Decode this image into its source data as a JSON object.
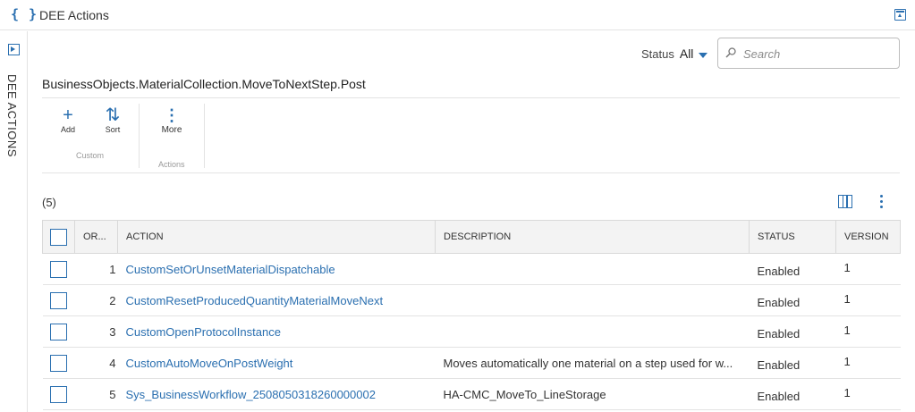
{
  "app": {
    "title": "DEE Actions",
    "rail_label": "DEE ACTIONS"
  },
  "filter": {
    "status_label": "Status",
    "status_value": "All"
  },
  "search": {
    "placeholder": "Search"
  },
  "entity_title": "BusinessObjects.MaterialCollection.MoveToNextStep.Post",
  "toolbar": {
    "add_label": "Add",
    "sort_label": "Sort",
    "custom_group": "Custom",
    "more_label": "More",
    "actions_group": "Actions"
  },
  "grid": {
    "count": "(5)",
    "columns": {
      "order": "OR...",
      "action": "ACTION",
      "description": "DESCRIPTION",
      "status": "STATUS",
      "version": "VERSION"
    },
    "rows": [
      {
        "order": "1",
        "action": "CustomSetOrUnsetMaterialDispatchable",
        "description": "",
        "status": "Enabled",
        "version": "1"
      },
      {
        "order": "2",
        "action": "CustomResetProducedQuantityMaterialMoveNext",
        "description": "",
        "status": "Enabled",
        "version": "1"
      },
      {
        "order": "3",
        "action": "CustomOpenProtocolInstance",
        "description": "",
        "status": "Enabled",
        "version": "1"
      },
      {
        "order": "4",
        "action": "CustomAutoMoveOnPostWeight",
        "description": "Moves automatically one material on a step used for w...",
        "status": "Enabled",
        "version": "1"
      },
      {
        "order": "5",
        "action": "Sys_BusinessWorkflow_2508050318260000002",
        "description": "HA-CMC_MoveTo_LineStorage",
        "status": "Enabled",
        "version": "1"
      }
    ]
  },
  "colors": {
    "accent": "#2a6fb0",
    "header_bg": "#f3f3f3",
    "border": "#d9d9d9"
  }
}
